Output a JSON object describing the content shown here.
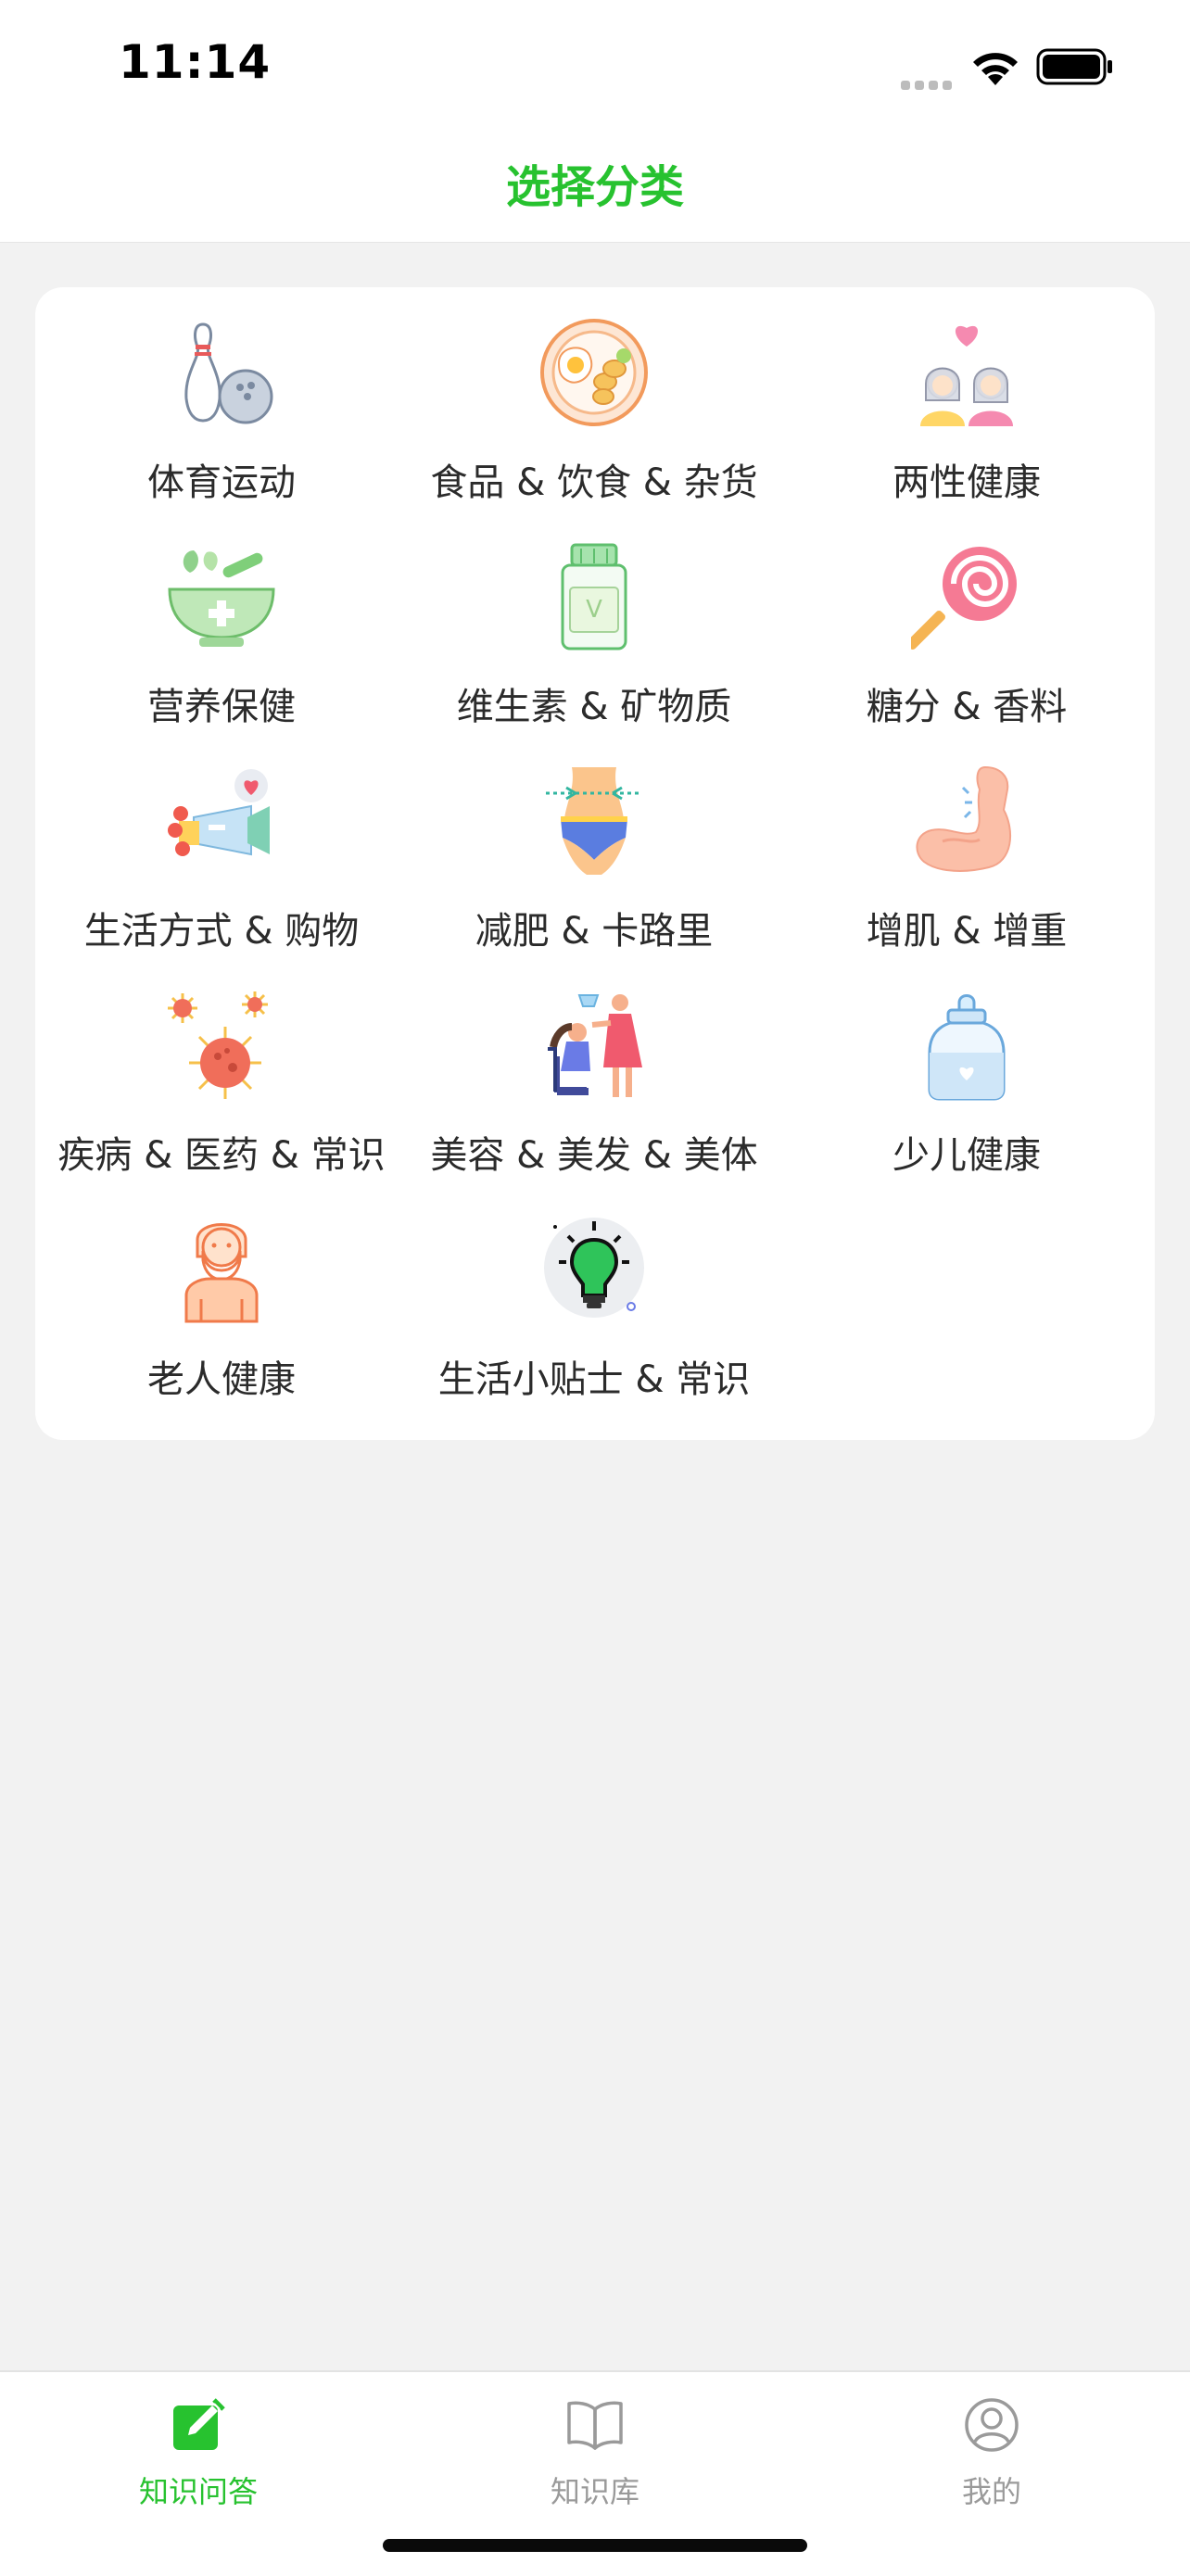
{
  "status_bar": {
    "time": "11:14"
  },
  "header": {
    "title": "选择分类"
  },
  "categories": [
    {
      "label": "体育运动",
      "icon": "bowling-icon"
    },
    {
      "label": "食品 & 饮食 & 杂货",
      "icon": "breakfast-plate-icon"
    },
    {
      "label": "两性健康",
      "icon": "couple-heart-icon"
    },
    {
      "label": "营养保健",
      "icon": "mortar-herb-icon"
    },
    {
      "label": "维生素 & 矿物质",
      "icon": "vitamin-bottle-icon"
    },
    {
      "label": "糖分 & 香料",
      "icon": "lollipop-icon"
    },
    {
      "label": "生活方式 & 购物",
      "icon": "megaphone-gift-icon"
    },
    {
      "label": "减肥 & 卡路里",
      "icon": "waist-measure-icon"
    },
    {
      "label": "增肌 & 增重",
      "icon": "muscle-arm-icon"
    },
    {
      "label": "疾病 & 医药 & 常识",
      "icon": "virus-icon"
    },
    {
      "label": "美容 & 美发 & 美体",
      "icon": "hair-salon-icon"
    },
    {
      "label": "少儿健康",
      "icon": "baby-bottle-icon"
    },
    {
      "label": "老人健康",
      "icon": "old-man-icon"
    },
    {
      "label": "生活小贴士 & 常识",
      "icon": "lightbulb-icon"
    }
  ],
  "tabbar": {
    "items": [
      {
        "label": "知识问答",
        "icon": "edit-square-icon",
        "active": true
      },
      {
        "label": "知识库",
        "icon": "open-book-icon",
        "active": false
      },
      {
        "label": "我的",
        "icon": "user-circle-icon",
        "active": false
      }
    ]
  },
  "colors": {
    "accent": "#27c22f",
    "tab_inactive": "#9a9a9a",
    "background": "#f2f2f2",
    "card": "#ffffff",
    "text": "#2b2b2b"
  }
}
